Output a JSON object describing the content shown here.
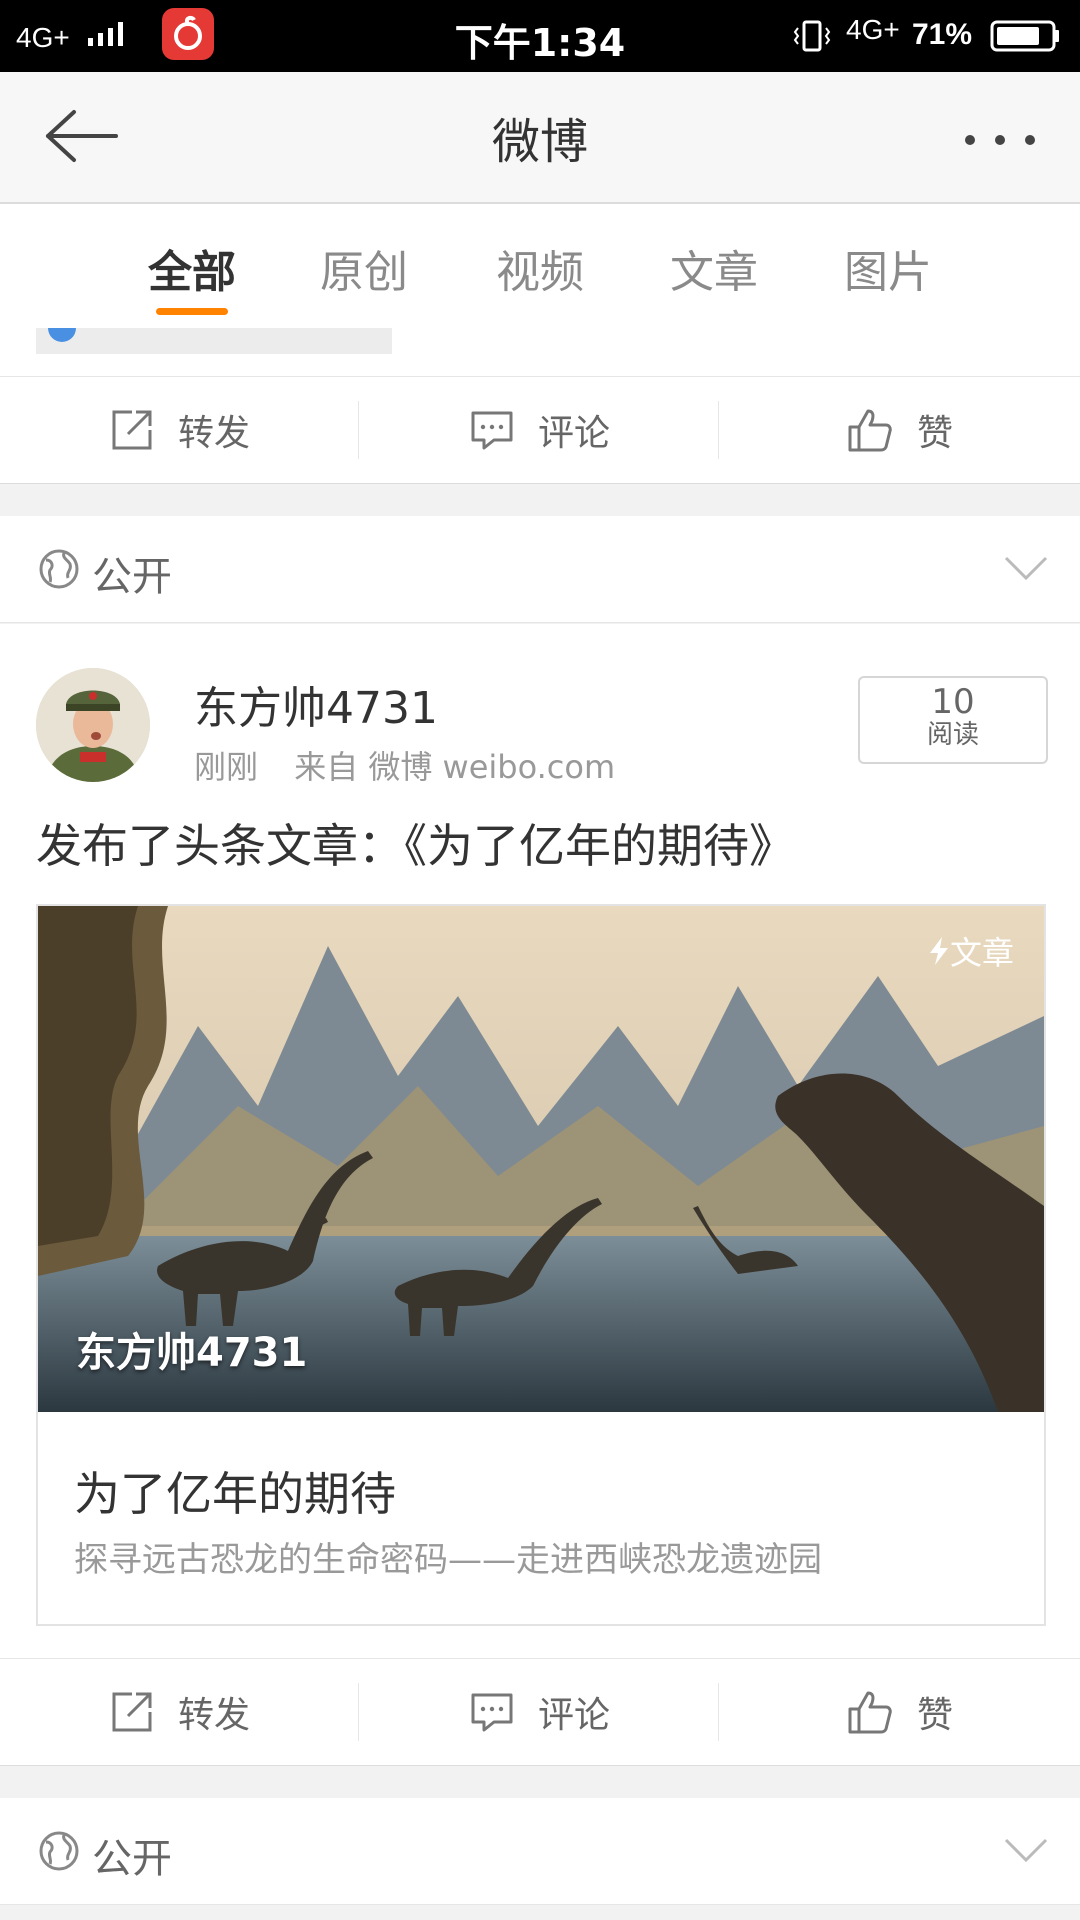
{
  "status_bar": {
    "network": "4G+",
    "time": "下午1:34",
    "network2": "4G+",
    "battery": "71%"
  },
  "header": {
    "title": "微博"
  },
  "tabs": [
    {
      "label": "全部",
      "active": true
    },
    {
      "label": "原创"
    },
    {
      "label": "视频"
    },
    {
      "label": "文章"
    },
    {
      "label": "图片"
    }
  ],
  "actions": {
    "repost": "转发",
    "comment": "评论",
    "like": "赞"
  },
  "visibility_label": "公开",
  "post": {
    "username": "东方帅4731",
    "time": "刚刚",
    "source": "来自 微博 weibo.com",
    "read_count": "10",
    "read_label": "阅读",
    "text": "发布了头条文章：《为了亿年的期待》",
    "article": {
      "tag": "文章",
      "image_author": "东方帅4731",
      "title": "为了亿年的期待",
      "subtitle": "探寻远古恐龙的生命密码——走进西峡恐龙遗迹园"
    }
  },
  "colors": {
    "accent": "#ff8200",
    "background": "#f2f2f2",
    "text": "#333333",
    "muted": "#999999"
  }
}
